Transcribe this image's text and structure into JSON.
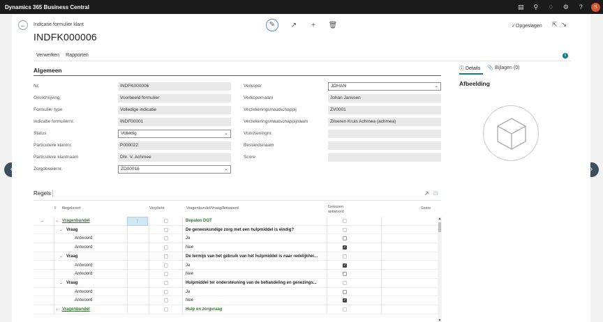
{
  "app": {
    "title": "Dynamics 365 Business Central",
    "avatar_letter": "S"
  },
  "topbar_icons": [
    "document-icon",
    "search-icon",
    "bell-icon",
    "gear-icon",
    "help-icon"
  ],
  "header": {
    "breadcrumb": "Indicatie formulier klant",
    "record_title": "INDFK000006",
    "saved_label": "Opgeslagen"
  },
  "menu": {
    "items": [
      "Verwerken",
      "Rapporten"
    ]
  },
  "general": {
    "title": "Algemeen",
    "left_fields": [
      {
        "label": "Nr.",
        "value": "INDFK000006",
        "type": "text"
      },
      {
        "label": "Omschrijving",
        "value": "Voorbeeld formulier",
        "type": "text"
      },
      {
        "label": "Formulier type",
        "value": "Volledige indicatie",
        "type": "text"
      },
      {
        "label": "Indicatie formuliernr.",
        "value": "INDF00001",
        "type": "text"
      },
      {
        "label": "Status",
        "value": "Volledig",
        "type": "select"
      },
      {
        "label": "Particuliere klantnr.",
        "value": "P000022",
        "type": "text"
      },
      {
        "label": "Particuliere klantnaam",
        "value": "Dhr. V. Achmee",
        "type": "text"
      },
      {
        "label": "Zorgdossiernr.",
        "value": "ZD00016",
        "type": "select"
      }
    ],
    "right_fields": [
      {
        "label": "Verkoper",
        "value": "JOHAN",
        "type": "select"
      },
      {
        "label": "Verkopernaam",
        "value": "Johan Janssen",
        "type": "text"
      },
      {
        "label": "Verzekeringsmaatschappij",
        "value": "ZV0001",
        "type": "text"
      },
      {
        "label": "Verzekeringsmaatschappijnaam",
        "value": "Zilveren Kruis Achmea (achmea)",
        "type": "text"
      },
      {
        "label": "Voorzieningnr.",
        "value": "",
        "type": "text"
      },
      {
        "label": "Bestandsnaam",
        "value": "",
        "type": "text"
      },
      {
        "label": "Score",
        "value": "",
        "type": "text"
      }
    ]
  },
  "factbox": {
    "tabs": [
      "Details",
      "Bijlagen (0)"
    ],
    "image_title": "Afbeelding"
  },
  "lines": {
    "title": "Regels",
    "columns": {
      "regelsoort": "Regelsoort",
      "verplicht": "Verplicht",
      "vraag": "Vragenbundel/Vraag/Antwoord",
      "gekozen": "Gekozen antwoord",
      "score": "Score"
    },
    "rows": [
      {
        "indent": 0,
        "type": "Vragenbundel",
        "text": "Bepalen DOT",
        "verplicht": false,
        "gekozen": false,
        "style": "bundle",
        "current": true
      },
      {
        "indent": 1,
        "type": "Vraag",
        "text": "De geneeskundige zorg met een hulpmiddel is eindig?",
        "verplicht": false,
        "gekozen": false,
        "style": "question"
      },
      {
        "indent": 2,
        "type": "Antwoord",
        "text": "Ja",
        "verplicht": false,
        "gekozen": false,
        "style": "answer"
      },
      {
        "indent": 2,
        "type": "Antwoord",
        "text": "Nee",
        "verplicht": false,
        "gekozen": true,
        "style": "answer"
      },
      {
        "indent": 1,
        "type": "Vraag",
        "text": "De termijn van het gebruik van het hulpmiddel is naar redelijkhei...",
        "verplicht": false,
        "gekozen": false,
        "style": "question"
      },
      {
        "indent": 2,
        "type": "Antwoord",
        "text": "Ja",
        "verplicht": false,
        "gekozen": true,
        "style": "answer"
      },
      {
        "indent": 2,
        "type": "Antwoord",
        "text": "Nee",
        "verplicht": false,
        "gekozen": false,
        "style": "answer"
      },
      {
        "indent": 1,
        "type": "Vraag",
        "text": "Hulpmiddel ter ondersteuning van de behandeling en genezings...",
        "verplicht": false,
        "gekozen": false,
        "style": "question"
      },
      {
        "indent": 2,
        "type": "Antwoord",
        "text": "Ja",
        "verplicht": false,
        "gekozen": false,
        "style": "answer"
      },
      {
        "indent": 2,
        "type": "Antwoord",
        "text": "Nee",
        "verplicht": false,
        "gekozen": true,
        "style": "answer"
      },
      {
        "indent": 0,
        "type": "Vragenbundel",
        "text": "Hulp en zorgvraag",
        "verplicht": false,
        "gekozen": false,
        "style": "bundle"
      }
    ]
  }
}
